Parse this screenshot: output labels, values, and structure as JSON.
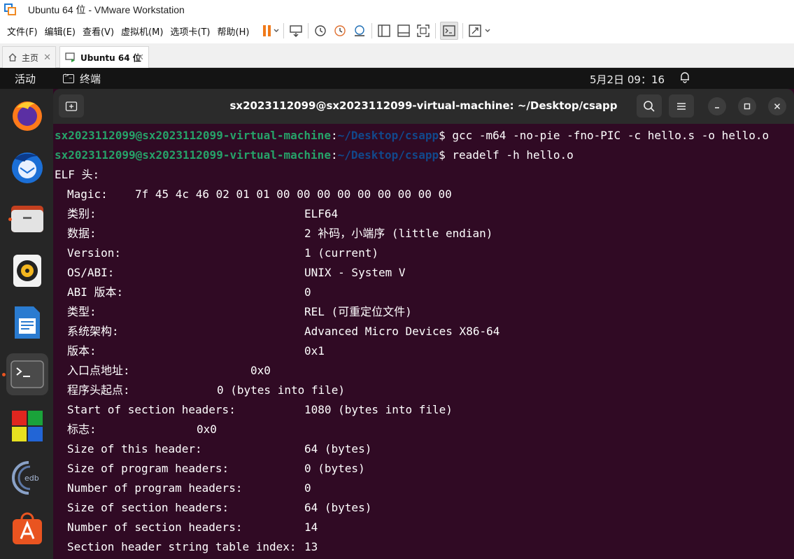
{
  "window": {
    "title": "Ubuntu 64 位 - VMware Workstation"
  },
  "menu": [
    "文件(F)",
    "编辑(E)",
    "查看(V)",
    "虚拟机(M)",
    "选项卡(T)",
    "帮助(H)"
  ],
  "tabs": [
    {
      "label": "主页"
    },
    {
      "label": "Ubuntu 64 位"
    }
  ],
  "ubuntu": {
    "activities": "活动",
    "app_name": "终端",
    "clock": "5月2日 09：16"
  },
  "terminal": {
    "title": "sx2023112099@sx2023112099-virtual-machine: ~/Desktop/csapp",
    "prompts": [
      {
        "user": "sx2023112099@sx2023112099-virtual-machine",
        "sep": ":",
        "path": "~/Desktop/csapp",
        "dollar": "$",
        "cmd": " gcc -m64 -no-pie -fno-PIC -c hello.s -o hello.o"
      },
      {
        "user": "sx2023112099@sx2023112099-virtual-machine",
        "sep": ":",
        "path": "~/Desktop/csapp",
        "dollar": "$",
        "cmd": " readelf -h hello.o"
      }
    ],
    "elf_header_title": "ELF 头:",
    "rows": [
      {
        "label": "Magic:",
        "value": "7f 45 4c 46 02 01 01 00 00 00 00 00 00 00 00 00"
      },
      {
        "label": "类别:",
        "value": "ELF64"
      },
      {
        "label": "数据:",
        "value": "2 补码，小端序 (little endian)"
      },
      {
        "label": "Version:",
        "value": "1 (current)"
      },
      {
        "label": "OS/ABI:",
        "value": "UNIX - System V"
      },
      {
        "label": "ABI 版本:",
        "value": "0"
      },
      {
        "label": "类型:",
        "value": "REL (可重定位文件)"
      },
      {
        "label": "系统架构:",
        "value": "Advanced Micro Devices X86-64"
      },
      {
        "label": "版本:",
        "value": "0x1"
      },
      {
        "label": "入口点地址:",
        "value": "0x0"
      },
      {
        "label": "程序头起点:",
        "value": "0 (bytes into file)"
      },
      {
        "label": "Start of section headers:",
        "value": "1080 (bytes into file)"
      },
      {
        "label": "标志:",
        "value": "0x0"
      },
      {
        "label": "Size of this header:",
        "value": "64 (bytes)"
      },
      {
        "label": "Size of program headers:",
        "value": "0 (bytes)"
      },
      {
        "label": "Number of program headers:",
        "value": "0"
      },
      {
        "label": "Size of section headers:",
        "value": "64 (bytes)"
      },
      {
        "label": "Number of section headers:",
        "value": "14"
      },
      {
        "label": "Section header string table index:",
        "value": "13"
      }
    ]
  },
  "dock": [
    "firefox-icon",
    "thunderbird-icon",
    "files-icon",
    "rhythmbox-icon",
    "libreoffice-writer-icon",
    "terminal-icon",
    "cube-game-icon",
    "edb-debugger-icon",
    "app-center-icon"
  ],
  "colors": {
    "terminal_bg": "#300a24",
    "prompt_user": "#26a269",
    "prompt_path": "#12488b",
    "ubuntu_orange": "#e95420"
  }
}
